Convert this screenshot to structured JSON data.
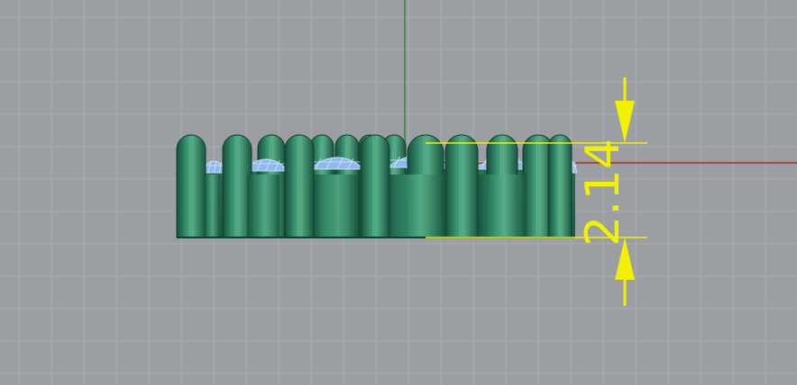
{
  "viewport": {
    "background_color": "#9b9ea2",
    "grid_color": "#a9acb0",
    "x_axis_color": "#b02a24",
    "y_axis_color": "#2f8a3c"
  },
  "model": {
    "body_color": "#2e7d5b",
    "highlight_color": "#52a882",
    "gem_color": "#8fb8ee"
  },
  "dimension": {
    "text": "2.14",
    "color": "#f2f200"
  }
}
